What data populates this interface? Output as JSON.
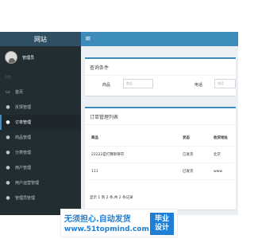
{
  "brand": "网站",
  "header": {
    "menu_icon": "≡"
  },
  "sidebar": {
    "username": "管理员",
    "section": "导航",
    "items": [
      {
        "icon": "▭",
        "label": "首页"
      },
      {
        "icon": "●",
        "label": "反馈管理"
      },
      {
        "icon": "●",
        "label": "订单管理"
      },
      {
        "icon": "●",
        "label": "商品管理"
      },
      {
        "icon": "●",
        "label": "分类管理"
      },
      {
        "icon": "●",
        "label": "用户管理"
      },
      {
        "icon": "●",
        "label": "用户运营管理"
      },
      {
        "icon": "●",
        "label": "管理员管理"
      }
    ]
  },
  "filter": {
    "title": "查询条件",
    "product_label": "商品",
    "product_placeholder": "商品",
    "phone_label": "电话",
    "phone_placeholder": "电话"
  },
  "orders": {
    "title": "订单管理列表",
    "columns": [
      "商品",
      "状态",
      "收货地址"
    ],
    "rows": [
      [
        "22222是打算斯蒂芬",
        "已发货",
        "北京"
      ],
      [
        "111",
        "已发货",
        "www"
      ]
    ],
    "pager": "显示 1 到 2 条,共 2 条记录"
  },
  "watermark": {
    "line1": "无须担心.自动发货",
    "line2": "www.51topmind.com",
    "badge1": "毕业",
    "badge2": "设计"
  }
}
